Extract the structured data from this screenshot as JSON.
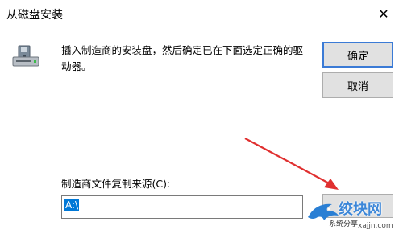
{
  "window": {
    "title": "从磁盘安装",
    "close_glyph": "✕"
  },
  "message": {
    "text": "插入制造商的安装盘，然后确定已在下面选定正确的驱动器。"
  },
  "buttons": {
    "ok_label": "确定",
    "cancel_label": "取消",
    "browse_label": ""
  },
  "source": {
    "label": "制造商文件复制来源(C):",
    "value": "A:\\"
  },
  "watermark": {
    "brand": "绞块网",
    "url": "xajjn.com",
    "tag": "系统分享"
  },
  "colors": {
    "accent": "#0078d7",
    "arrow": "#e03030",
    "button_bg": "#e1e1e1"
  },
  "icons": {
    "disk": "floppy-drive-icon",
    "close": "close-icon"
  }
}
